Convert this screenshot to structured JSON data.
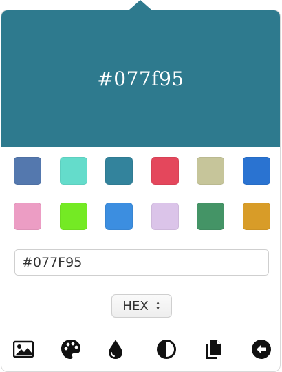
{
  "preview": {
    "color": "#2e7a8e",
    "text": "#077f95"
  },
  "swatches": [
    {
      "color": "#5478ae"
    },
    {
      "color": "#64dccb"
    },
    {
      "color": "#33839c"
    },
    {
      "color": "#e4475c"
    },
    {
      "color": "#c6c59a"
    },
    {
      "color": "#2a73d1"
    },
    {
      "color": "#ec9dc4"
    },
    {
      "color": "#74ea24"
    },
    {
      "color": "#3c8ee0"
    },
    {
      "color": "#dbc4e9"
    },
    {
      "color": "#449466"
    },
    {
      "color": "#d89c28"
    }
  ],
  "hex_input": {
    "value": "#077F95"
  },
  "format_select": {
    "value": "HEX"
  },
  "toolbar": {
    "icons": [
      "image-icon",
      "palette-icon",
      "drop-icon",
      "contrast-icon",
      "copy-icon",
      "back-icon"
    ]
  }
}
